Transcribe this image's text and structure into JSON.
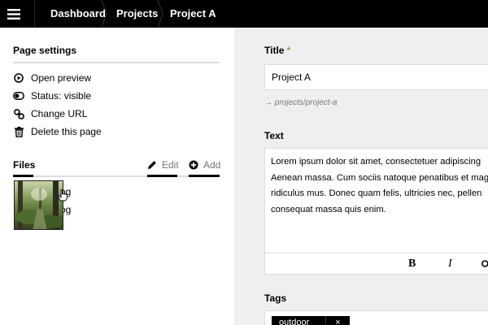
{
  "topbar": {
    "menu_icon": "hamburger-icon",
    "breadcrumb": [
      "Dashboard",
      "Projects",
      "Project A"
    ]
  },
  "sidebar": {
    "page_settings_title": "Page settings",
    "options": [
      {
        "label": "Open preview",
        "icon": "preview-icon"
      },
      {
        "label": "Status: visible",
        "icon": "toggle-icon"
      },
      {
        "label": "Change URL",
        "icon": "link-icon"
      },
      {
        "label": "Delete this page",
        "icon": "trash-icon"
      }
    ],
    "files": {
      "title": "Files",
      "edit_label": "Edit",
      "add_label": "Add",
      "items": [
        "og",
        "og"
      ]
    }
  },
  "form": {
    "title_label": "Title",
    "required_mark": "*",
    "title_value": "Project A",
    "url_hint": "→ projects/project-a",
    "text_label": "Text",
    "text_lines": [
      "Lorem ipsum dolor sit amet, consectetuer adipiscing",
      "Aenean massa. Cum sociis natoque penatibus et mag",
      "ridiculus mus. Donec quam felis, ultricies nec, pellen",
      "consequat massa quis enim."
    ],
    "toolbar": {
      "bold": "B",
      "italic": "I"
    },
    "tags_label": "Tags",
    "tag": {
      "label": "outdoor",
      "remove": "×"
    }
  },
  "colors": {
    "topbar": "#000000",
    "required": "#81a844",
    "sidebar_bg": "#ffffff",
    "main_bg": "#efefef"
  }
}
